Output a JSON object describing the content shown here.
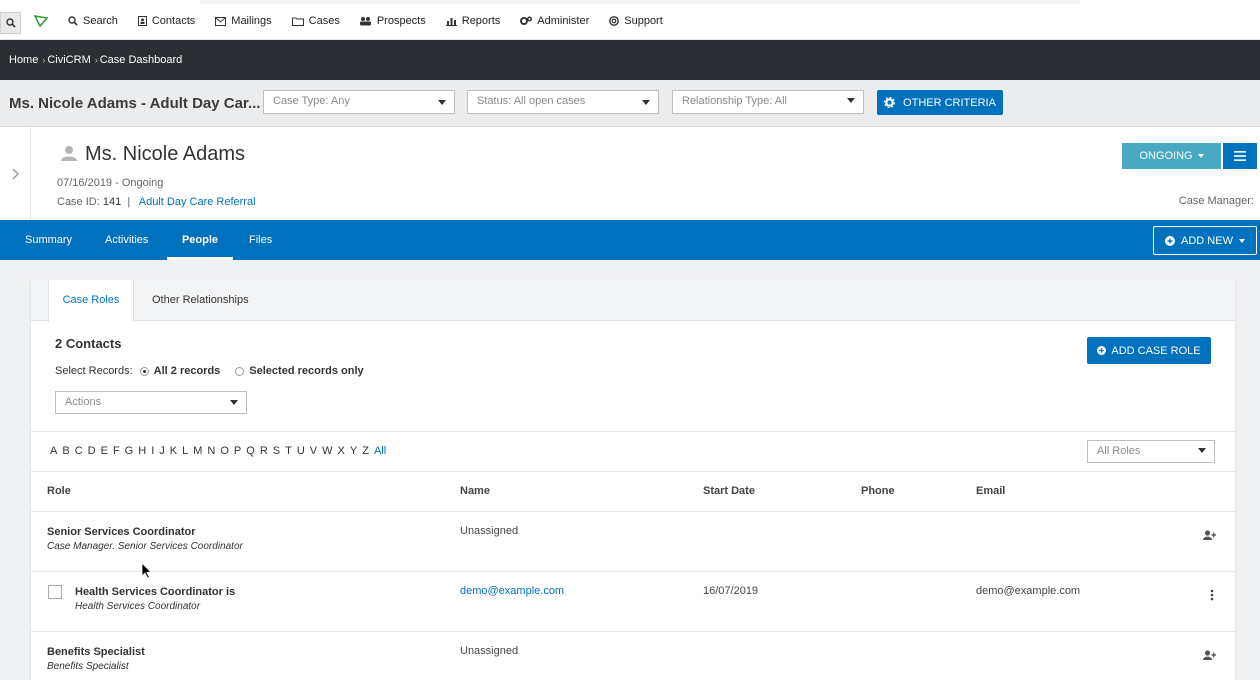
{
  "topbar": {
    "menu": [
      {
        "label": "Search",
        "icon": "search-icon"
      },
      {
        "label": "Contacts",
        "icon": "contacts-icon"
      },
      {
        "label": "Mailings",
        "icon": "mail-icon"
      },
      {
        "label": "Cases",
        "icon": "folder-icon"
      },
      {
        "label": "Prospects",
        "icon": "users-icon"
      },
      {
        "label": "Reports",
        "icon": "bar-chart-icon"
      },
      {
        "label": "Administer",
        "icon": "gears-icon"
      },
      {
        "label": "Support",
        "icon": "lifebuoy-icon"
      }
    ]
  },
  "breadcrumb": [
    "Home",
    "CiviCRM",
    "Case Dashboard"
  ],
  "filters": {
    "case_title": "Ms. Nicole Adams - Adult Day Car...",
    "case_type": "Case Type: Any",
    "status": "Status: All open cases",
    "relationship_type": "Relationship Type: All",
    "other_criteria": "OTHER CRITERIA"
  },
  "case": {
    "name": "Ms. Nicole Adams",
    "date_status": "07/16/2019 - Ongoing",
    "case_id_label": "Case ID:",
    "case_id": "141",
    "case_type_link": "Adult Day Care Referral",
    "status_button": "ONGOING",
    "manager_label": "Case Manager:"
  },
  "tabs": [
    "Summary",
    "Activities",
    "People",
    "Files"
  ],
  "active_tab": "People",
  "add_new": "ADD NEW",
  "people": {
    "subtabs": [
      "Case Roles",
      "Other Relationships"
    ],
    "count": "2 Contacts",
    "select_records_label": "Select Records:",
    "option_all": "All 2 records",
    "option_selected": "Selected records only",
    "actions_placeholder": "Actions",
    "add_case_role": "ADD CASE ROLE",
    "alphabet": [
      "A",
      "B",
      "C",
      "D",
      "E",
      "F",
      "G",
      "H",
      "I",
      "J",
      "K",
      "L",
      "M",
      "N",
      "O",
      "P",
      "Q",
      "R",
      "S",
      "T",
      "U",
      "V",
      "W",
      "X",
      "Y",
      "Z"
    ],
    "alphabet_all": "All",
    "roles_filter": "All Roles",
    "columns": [
      "Role",
      "Name",
      "Start Date",
      "Phone",
      "Email"
    ],
    "rows": [
      {
        "role": "Senior Services Coordinator",
        "sub": "Case Manager. Senior Services Coordinator",
        "name": "Unassigned",
        "start": "",
        "phone": "",
        "email": ""
      },
      {
        "role": "Health Services Coordinator is",
        "sub": "Health Services Coordinator",
        "name": "demo@example.com",
        "start": "16/07/2019",
        "phone": "",
        "email": "demo@example.com"
      },
      {
        "role": "Benefits Specialist",
        "sub": "Benefits Specialist",
        "name": "Unassigned",
        "start": "",
        "phone": "",
        "email": ""
      }
    ]
  },
  "colors": {
    "primary": "#0071bd",
    "status": "#48a9c5",
    "dark": "#2b2f33"
  }
}
